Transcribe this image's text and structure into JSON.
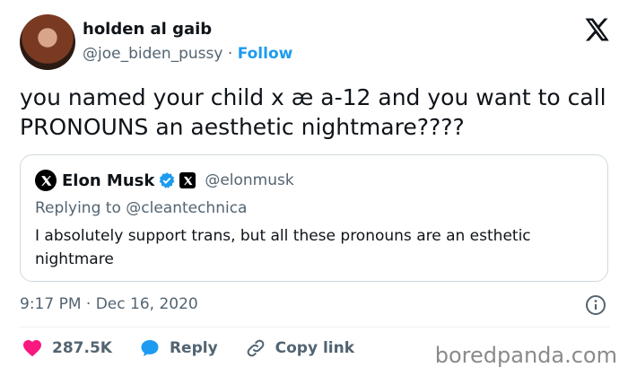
{
  "author": {
    "name": "holden al gaib",
    "handle": "@joe_biden_pussy",
    "separator": "·",
    "follow_label": "Follow"
  },
  "tweet": {
    "text": "you named your child x æ a-12 and you want to call PRONOUNS an aesthetic nightmare????",
    "timestamp": "9:17 PM · Dec 16, 2020"
  },
  "quoted": {
    "name": "Elon Musk",
    "handle": "@elonmusk",
    "replying_to": "Replying to @cleantechnica",
    "text": "I absolutely support trans, but all these pronouns are an esthetic nightmare"
  },
  "actions": {
    "likes": "287.5K",
    "reply_label": "Reply",
    "copy_link_label": "Copy link"
  },
  "watermark": "boredpanda.com",
  "colors": {
    "link_blue": "#1d9bf0",
    "like_red": "#f91880",
    "muted": "#536471"
  },
  "icons": [
    "x-logo-icon",
    "verified-badge-icon",
    "affiliate-x-icon",
    "info-icon",
    "heart-icon",
    "reply-icon",
    "link-icon"
  ]
}
